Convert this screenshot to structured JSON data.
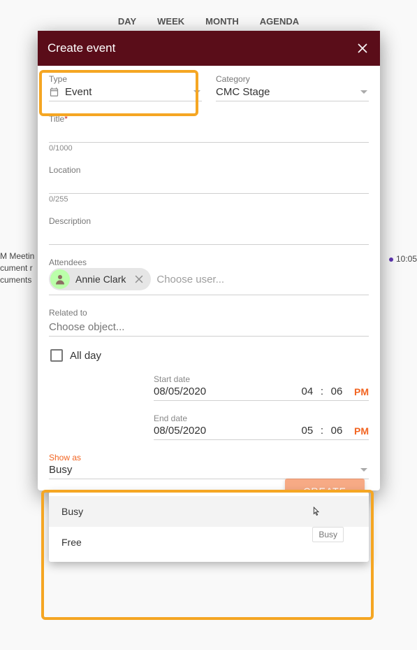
{
  "bg": {
    "tabs": [
      "DAY",
      "WEEK",
      "MONTH",
      "AGENDA"
    ],
    "left_event": [
      "M Meetin",
      "cument r",
      "cuments"
    ],
    "right_event": "10:05"
  },
  "modal": {
    "title": "Create event",
    "type": {
      "label": "Type",
      "value": "Event"
    },
    "category": {
      "label": "Category",
      "value": "CMC Stage"
    },
    "titlefield": {
      "label": "Title",
      "counter": "0/1000"
    },
    "location": {
      "label": "Location",
      "counter": "0/255"
    },
    "description": {
      "label": "Description"
    },
    "attendees": {
      "label": "Attendees",
      "chip": "Annie Clark",
      "placeholder": "Choose user..."
    },
    "related": {
      "label": "Related to",
      "placeholder": "Choose object..."
    },
    "allday": "All day",
    "start": {
      "label": "Start date",
      "date": "08/05/2020",
      "hh": "04",
      "mm": "06",
      "ampm": "PM"
    },
    "end": {
      "label": "End date",
      "date": "08/05/2020",
      "hh": "05",
      "mm": "06",
      "ampm": "PM"
    },
    "showas": {
      "label": "Show as",
      "value": "Busy",
      "options": [
        "Busy",
        "Free"
      ],
      "tooltip": "Busy"
    },
    "create": "CREATE"
  }
}
